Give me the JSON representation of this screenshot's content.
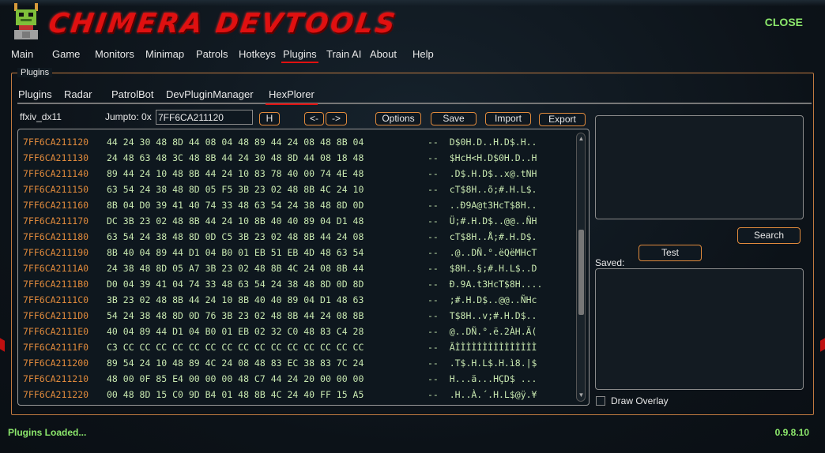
{
  "header": {
    "title": "CHIMERA DEVTOOLS",
    "close_label": "CLOSE"
  },
  "main_nav": {
    "items": [
      "Main",
      "Game",
      "Monitors",
      "Minimap",
      "Patrols",
      "Hotkeys",
      "Plugins",
      "Train AI",
      "About",
      "Help"
    ],
    "active": "Plugins"
  },
  "plugins_panel": {
    "legend": "Plugins",
    "tabs": [
      "Plugins",
      "Radar",
      "PatrolBot",
      "DevPluginManager",
      "HexPlorer"
    ],
    "active_tab": "HexPlorer"
  },
  "hexplorer": {
    "process_label": "ffxiv_dx11",
    "jumpto_label": "Jumpto: 0x",
    "jumpto_value": "7FF6CA211120",
    "go_button": "H",
    "prev_button": "<-",
    "next_button": "->",
    "options_button": "Options",
    "save_button": "Save",
    "import_button": "Import",
    "export_button": "Export",
    "search_button": "Search",
    "test_button": "Test",
    "saved_label": "Saved:",
    "draw_overlay_label": "Draw Overlay",
    "rows": [
      {
        "addr": "7FF6CA211120",
        "bytes": "44 24 30 48 8D 44 08 04 48 89 44 24 08 48 8B 04",
        "ascii": "--  D$0H.D..H.D$.H.."
      },
      {
        "addr": "7FF6CA211130",
        "bytes": "24 48 63 48 3C 48 8B 44 24 30 48 8D 44 08 18 48",
        "ascii": "--  $HcH<H.D$0H.D..H"
      },
      {
        "addr": "7FF6CA211140",
        "bytes": "89 44 24 10 48 8B 44 24 10 83 78 40 00 74 4E 48",
        "ascii": "--  .D$.H.D$..x@.tNH"
      },
      {
        "addr": "7FF6CA211150",
        "bytes": "63 54 24 38 48 8D 05 F5 3B 23 02 48 8B 4C 24 10",
        "ascii": "--  cT$8H..õ;#.H.L$."
      },
      {
        "addr": "7FF6CA211160",
        "bytes": "8B 04 D0 39 41 40 74 33 48 63 54 24 38 48 8D 0D",
        "ascii": "--  ..Ð9A@t3HcT$8H.."
      },
      {
        "addr": "7FF6CA211170",
        "bytes": "DC 3B 23 02 48 8B 44 24 10 8B 40 40 89 04 D1 48",
        "ascii": "--  Ü;#.H.D$..@@..ÑH"
      },
      {
        "addr": "7FF6CA211180",
        "bytes": "63 54 24 38 48 8D 0D C5 3B 23 02 48 8B 44 24 08",
        "ascii": "--  cT$8H..Å;#.H.D$."
      },
      {
        "addr": "7FF6CA211190",
        "bytes": "8B 40 04 89 44 D1 04 B0 01 EB 51 EB 4D 48 63 54",
        "ascii": "--  .@..DÑ.°.ëQëMHcT"
      },
      {
        "addr": "7FF6CA2111A0",
        "bytes": "24 38 48 8D 05 A7 3B 23 02 48 8B 4C 24 08 8B 44",
        "ascii": "--  $8H..§;#.H.L$..D"
      },
      {
        "addr": "7FF6CA2111B0",
        "bytes": "D0 04 39 41 04 74 33 48 63 54 24 38 48 8D 0D 8D",
        "ascii": "--  Ð.9A.t3HcT$8H...."
      },
      {
        "addr": "7FF6CA2111C0",
        "bytes": "3B 23 02 48 8B 44 24 10 8B 40 40 89 04 D1 48 63",
        "ascii": "--  ;#.H.D$..@@..ÑHc"
      },
      {
        "addr": "7FF6CA2111D0",
        "bytes": "54 24 38 48 8D 0D 76 3B 23 02 48 8B 44 24 08 8B",
        "ascii": "--  T$8H..v;#.H.D$.."
      },
      {
        "addr": "7FF6CA2111E0",
        "bytes": "40 04 89 44 D1 04 B0 01 EB 02 32 C0 48 83 C4 28",
        "ascii": "--  @..DÑ.°.ë.2ÀH.Ä("
      },
      {
        "addr": "7FF6CA2111F0",
        "bytes": "C3 CC CC CC CC CC CC CC CC CC CC CC CC CC CC CC",
        "ascii": "--  ÃÌÌÌÌÌÌÌÌÌÌÌÌÌÌÌ"
      },
      {
        "addr": "7FF6CA211200",
        "bytes": "89 54 24 10 48 89 4C 24 08 48 83 EC 38 83 7C 24",
        "ascii": "--  .T$.H.L$.H.ì8.|$"
      },
      {
        "addr": "7FF6CA211210",
        "bytes": "48 00 0F 85 E4 00 00 00 48 C7 44 24 20 00 00 00",
        "ascii": "--  H...ä...HÇD$ ..."
      },
      {
        "addr": "7FF6CA211220",
        "bytes": "00 48 8D 15 C0 9D B4 01 48 8B 4C 24 40 FF 15 A5",
        "ascii": "--  .H..À.´.H.L$@ÿ.¥"
      }
    ]
  },
  "footer": {
    "status": "Plugins Loaded...",
    "version": "0.9.8.10"
  },
  "colors": {
    "accent": "#e08a3c",
    "title_red": "#e01010",
    "status_green": "#8ce86c",
    "hex_text": "#c8e8b0"
  }
}
